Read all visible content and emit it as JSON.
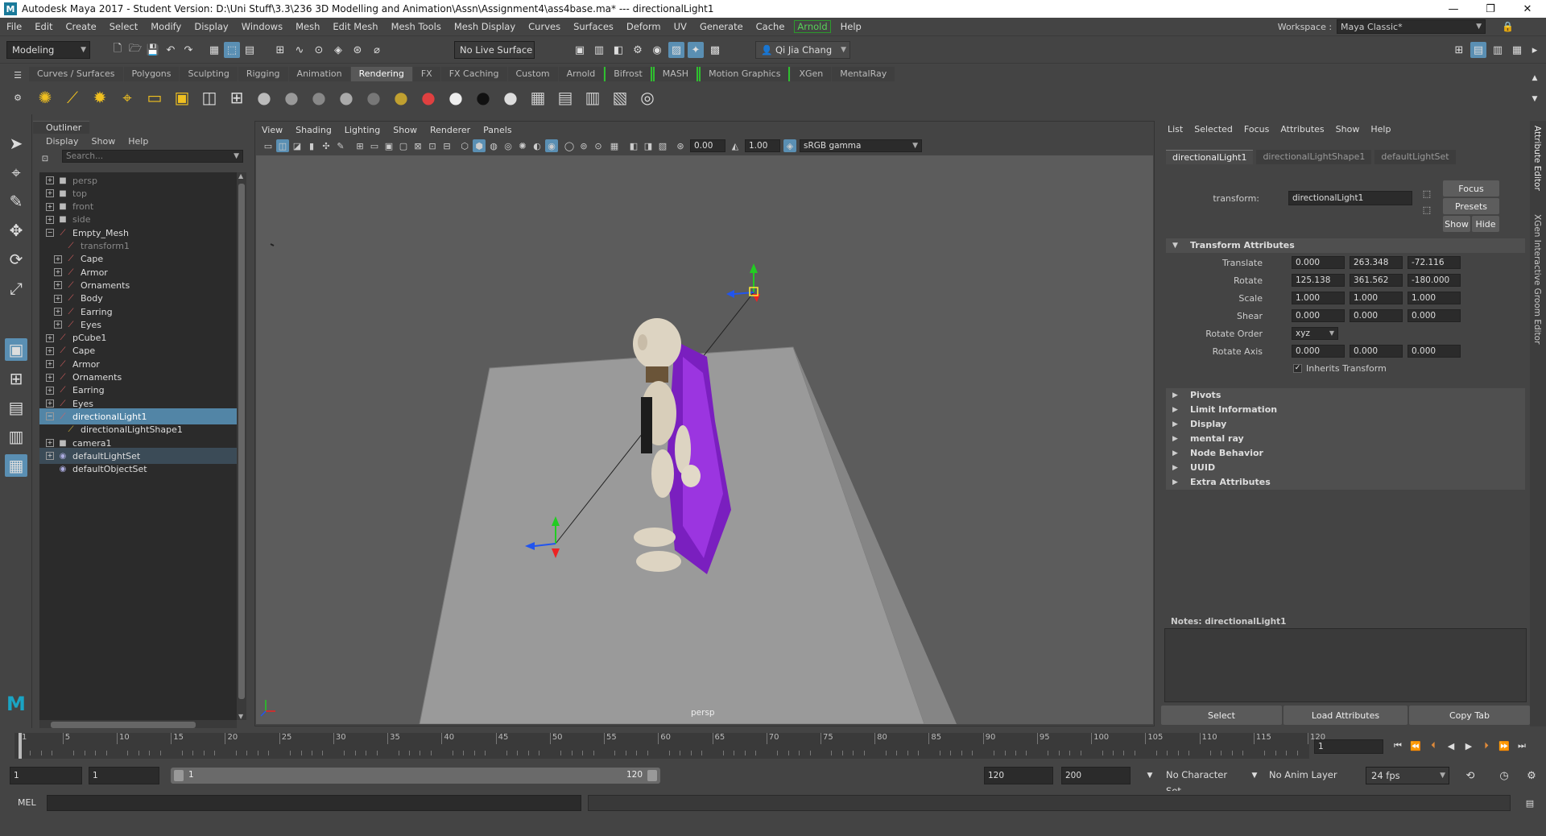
{
  "window": {
    "title": "Autodesk Maya 2017 - Student Version: D:\\Uni Stuff\\3.3\\236 3D Modelling and Animation\\Assn\\Assignment4\\ass4base.ma*  ---  directionalLight1"
  },
  "menubar": {
    "items": [
      "File",
      "Edit",
      "Create",
      "Select",
      "Modify",
      "Display",
      "Windows",
      "Mesh",
      "Edit Mesh",
      "Mesh Tools",
      "Mesh Display",
      "Curves",
      "Surfaces",
      "Deform",
      "UV",
      "Generate",
      "Cache",
      "Arnold",
      "Help"
    ],
    "workspace_label": "Workspace :",
    "workspace_value": "Maya Classic*"
  },
  "statusline": {
    "mode": "Modeling",
    "live_surface": "No Live Surface",
    "user": "Qi Jia Chang"
  },
  "shelf": {
    "tabs": [
      "Curves / Surfaces",
      "Polygons",
      "Sculpting",
      "Rigging",
      "Animation",
      "Rendering",
      "FX",
      "FX Caching",
      "Custom",
      "Arnold",
      "Bifrost",
      "MASH",
      "Motion Graphics",
      "XGen",
      "MentalRay"
    ],
    "active_tab": "Rendering",
    "icons": [
      "ambient-light",
      "directional-light",
      "point-light",
      "spot-light",
      "area-light",
      "volume-light",
      "camera-aim",
      "render-setup",
      "blinn",
      "lambert",
      "phong",
      "phong-e",
      "surface-shader",
      "anisotropic",
      "ramp-shader",
      "white-shader",
      "black-shader",
      "layered-shader",
      "hypershade",
      "render-view",
      "ipr-render",
      "batch-render",
      "render-settings"
    ]
  },
  "outliner": {
    "title": "Outliner",
    "menus": [
      "Display",
      "Show",
      "Help"
    ],
    "search_placeholder": "Search...",
    "items": [
      {
        "label": "persp",
        "indent": 1,
        "icon": "camera",
        "expand": true,
        "dim": true
      },
      {
        "label": "top",
        "indent": 1,
        "icon": "camera",
        "expand": true,
        "dim": true
      },
      {
        "label": "front",
        "indent": 1,
        "icon": "camera",
        "expand": true,
        "dim": true
      },
      {
        "label": "side",
        "indent": 1,
        "icon": "camera",
        "expand": true,
        "dim": true
      },
      {
        "label": "Empty_Mesh",
        "indent": 1,
        "icon": "transform",
        "expand": "open",
        "dim": false
      },
      {
        "label": "transform1",
        "indent": 2,
        "icon": "transform",
        "expand": false,
        "dim": true
      },
      {
        "label": "Cape",
        "indent": 2,
        "icon": "transform",
        "expand": true,
        "dim": false
      },
      {
        "label": "Armor",
        "indent": 2,
        "icon": "transform",
        "expand": true,
        "dim": false
      },
      {
        "label": "Ornaments",
        "indent": 2,
        "icon": "transform",
        "expand": true,
        "dim": false
      },
      {
        "label": "Body",
        "indent": 2,
        "icon": "transform",
        "expand": true,
        "dim": false
      },
      {
        "label": "Earring",
        "indent": 2,
        "icon": "transform",
        "expand": true,
        "dim": false
      },
      {
        "label": "Eyes",
        "indent": 2,
        "icon": "transform",
        "expand": true,
        "dim": false
      },
      {
        "label": "pCube1",
        "indent": 1,
        "icon": "transform",
        "expand": true,
        "dim": false
      },
      {
        "label": "Cape",
        "indent": 1,
        "icon": "transform",
        "expand": true,
        "dim": false
      },
      {
        "label": "Armor",
        "indent": 1,
        "icon": "transform",
        "expand": true,
        "dim": false
      },
      {
        "label": "Ornaments",
        "indent": 1,
        "icon": "transform",
        "expand": true,
        "dim": false
      },
      {
        "label": "Earring",
        "indent": 1,
        "icon": "transform",
        "expand": true,
        "dim": false
      },
      {
        "label": "Eyes",
        "indent": 1,
        "icon": "transform",
        "expand": true,
        "dim": false
      },
      {
        "label": "directionalLight1",
        "indent": 1,
        "icon": "transform",
        "expand": "open",
        "dim": false,
        "selected": true
      },
      {
        "label": "directionalLightShape1",
        "indent": 2,
        "icon": "light",
        "expand": false,
        "dim": false
      },
      {
        "label": "camera1",
        "indent": 1,
        "icon": "camera",
        "expand": true,
        "dim": false
      },
      {
        "label": "defaultLightSet",
        "indent": 1,
        "icon": "set",
        "expand": true,
        "dim": false,
        "highlight": true
      },
      {
        "label": "defaultObjectSet",
        "indent": 1,
        "icon": "set",
        "expand": false,
        "dim": false
      }
    ]
  },
  "viewport": {
    "menus": [
      "View",
      "Shading",
      "Lighting",
      "Show",
      "Renderer",
      "Panels"
    ],
    "exposure": "0.00",
    "gamma": "1.00",
    "colorspace": "sRGB gamma",
    "camera_label": "persp"
  },
  "attribute_editor": {
    "menus": [
      "List",
      "Selected",
      "Focus",
      "Attributes",
      "Show",
      "Help"
    ],
    "tabs": [
      "directionalLight1",
      "directionalLightShape1",
      "defaultLightSet"
    ],
    "transform_label": "transform:",
    "transform_value": "directionalLight1",
    "focus_btn": "Focus",
    "presets_btn": "Presets",
    "show_btn": "Show",
    "hide_btn": "Hide",
    "section_transform": "Transform Attributes",
    "translate_label": "Translate",
    "translate": [
      "0.000",
      "263.348",
      "-72.116"
    ],
    "rotate_label": "Rotate",
    "rotate": [
      "125.138",
      "361.562",
      "-180.000"
    ],
    "scale_label": "Scale",
    "scale": [
      "1.000",
      "1.000",
      "1.000"
    ],
    "shear_label": "Shear",
    "shear": [
      "0.000",
      "0.000",
      "0.000"
    ],
    "rotate_order_label": "Rotate Order",
    "rotate_order": "xyz",
    "rotate_axis_label": "Rotate Axis",
    "rotate_axis": [
      "0.000",
      "0.000",
      "0.000"
    ],
    "inherits_label": "Inherits Transform",
    "sections": [
      "Pivots",
      "Limit Information",
      "Display",
      "mental ray",
      "Node Behavior",
      "UUID",
      "Extra Attributes"
    ],
    "notes_label": "Notes:  directionalLight1",
    "select_btn": "Select",
    "load_btn": "Load Attributes",
    "copy_btn": "Copy Tab",
    "side_tabs": [
      "Attribute Editor",
      "XGen Interactive Groom Editor"
    ]
  },
  "timeline": {
    "ticks": [
      "1",
      "5",
      "10",
      "15",
      "20",
      "25",
      "30",
      "35",
      "40",
      "45",
      "50",
      "55",
      "60",
      "65",
      "70",
      "75",
      "80",
      "85",
      "90",
      "95",
      "100",
      "105",
      "110",
      "115",
      "120"
    ],
    "current_frame": "1",
    "range_start": "1",
    "range_start2": "1",
    "slider_start": "1",
    "slider_end": "120",
    "range_end": "120",
    "anim_end": "200",
    "character_set": "No Character Set",
    "anim_layer": "No Anim Layer",
    "fps": "24 fps"
  },
  "command": {
    "label": "MEL"
  }
}
